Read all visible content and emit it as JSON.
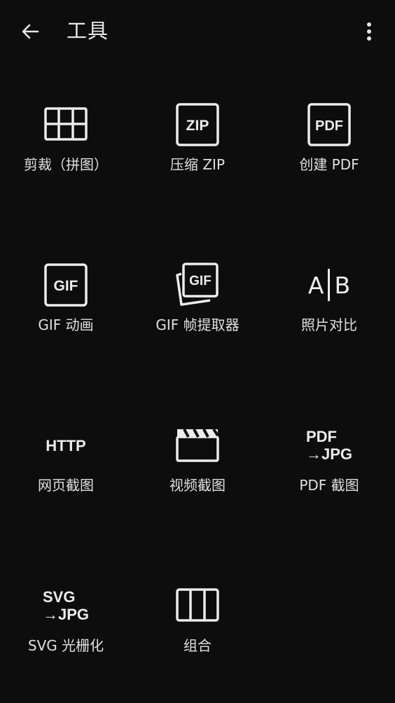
{
  "header": {
    "title": "工具",
    "back_icon": "arrow-left-icon",
    "menu_icon": "more-vert-icon"
  },
  "tools": [
    {
      "label": "剪裁（拼图）",
      "icon": "grid-crop-icon"
    },
    {
      "label": "压缩 ZIP",
      "icon": "zip-icon",
      "icon_text": "ZIP"
    },
    {
      "label": "创建 PDF",
      "icon": "pdf-icon",
      "icon_text": "PDF"
    },
    {
      "label": "GIF 动画",
      "icon": "gif-icon",
      "icon_text": "GIF"
    },
    {
      "label": "GIF 帧提取器",
      "icon": "gif-frames-icon",
      "icon_text": "GIF"
    },
    {
      "label": "照片对比",
      "icon": "compare-icon",
      "icon_text_left": "A",
      "icon_text_right": "B"
    },
    {
      "label": "网页截图",
      "icon": "http-icon",
      "icon_text": "HTTP"
    },
    {
      "label": "视频截图",
      "icon": "clapperboard-icon"
    },
    {
      "label": "PDF 截图",
      "icon": "pdf-to-jpg-icon",
      "icon_text_line1": "PDF",
      "icon_text_line2": "→JPG"
    },
    {
      "label": "SVG 光栅化",
      "icon": "svg-to-jpg-icon",
      "icon_text_line1": "SVG",
      "icon_text_line2": "→JPG"
    },
    {
      "label": "组合",
      "icon": "columns-icon"
    }
  ]
}
